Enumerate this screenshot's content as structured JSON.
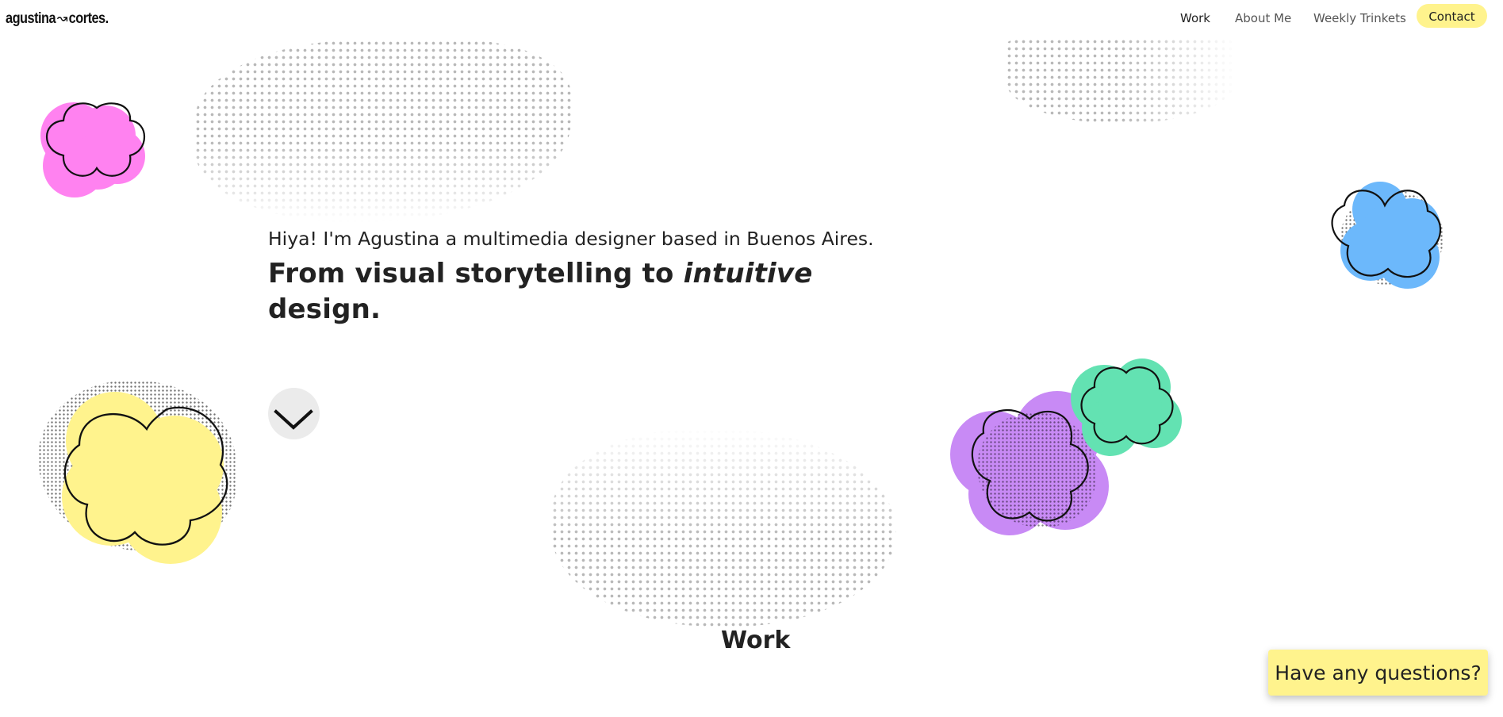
{
  "header": {
    "logo_first": "agustina",
    "logo_separator": "↝",
    "logo_second": "cortes."
  },
  "nav": {
    "items": [
      {
        "label": "Work",
        "active": true
      },
      {
        "label": "About Me",
        "active": false
      },
      {
        "label": "Weekly Trinkets",
        "active": false
      }
    ],
    "contact_label": "Contact"
  },
  "hero": {
    "intro": "Hiya! I'm Agustina a multimedia designer based in Buenos Aires.",
    "headline_part1": "From visual storytelling to ",
    "headline_emphasis": "intuitive",
    "headline_part2": "design.",
    "scroll_icon": "chevron-down-icon"
  },
  "section": {
    "title": "Work"
  },
  "cta": {
    "questions_label": "Have any questions?"
  },
  "colors": {
    "accent_yellow": "#fff38d",
    "flower_pink": "#ff82f0",
    "flower_blue": "#6cb8fb",
    "flower_yellow": "#fff38d",
    "flower_purple": "#c88af5",
    "flower_green": "#63e2b2"
  },
  "icons": {
    "logo_separator": "arrow-icon",
    "scroll": "chevron-down-icon",
    "decorations": [
      "pink-flower-icon",
      "blue-flower-icon",
      "yellow-flower-icon",
      "purple-flower-icon",
      "green-flower-icon"
    ]
  }
}
